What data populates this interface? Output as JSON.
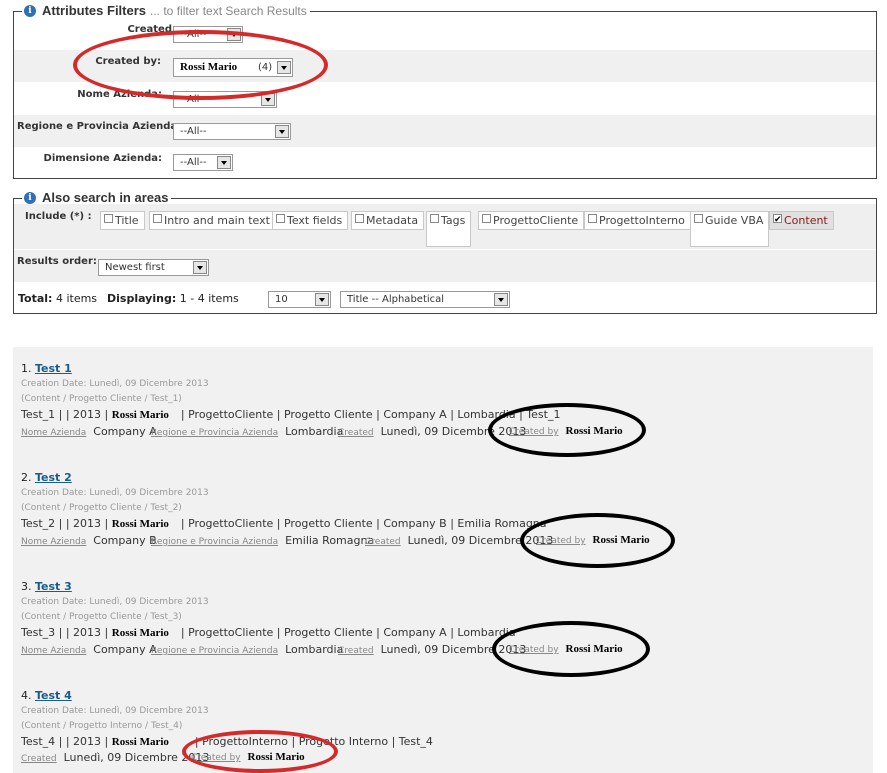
{
  "filters": {
    "legend_title": "Attributes Filters",
    "legend_sub": "... to filter text Search Results",
    "rows": [
      {
        "label": "Created:",
        "value": "--All--"
      },
      {
        "label": "Created by:",
        "value": "Rossi Mario",
        "count": "(4)"
      },
      {
        "label": "Nome Azienda:",
        "value": "--All--"
      },
      {
        "label": "Regione e Provincia Azienda:",
        "value": "--All--"
      },
      {
        "label": "Dimensione Azienda:",
        "value": "--All--"
      }
    ]
  },
  "areas": {
    "legend_title": "Also search in areas",
    "include_label": "Include (*) :",
    "checkboxes": [
      {
        "label": "Title",
        "checked": false
      },
      {
        "label": "Intro and main text",
        "checked": false
      },
      {
        "label": "Text fields",
        "checked": false
      },
      {
        "label": "Metadata",
        "checked": false
      },
      {
        "label": "Tags",
        "checked": false
      },
      {
        "label": "ProgettoCliente",
        "checked": false
      },
      {
        "label": "ProgettoInterno",
        "checked": false
      },
      {
        "label": "Guide VBA",
        "checked": false
      },
      {
        "label": "Content",
        "checked": true
      }
    ],
    "results_order_label": "Results order:",
    "results_order_value": "Newest first"
  },
  "summary": {
    "total_label": "Total:",
    "total_value": "4 items",
    "displaying_label": "Displaying:",
    "displaying_value": "1 - 4 items",
    "per_page": "10",
    "sort": "Title -- Alphabetical"
  },
  "results": [
    {
      "num": "1.",
      "title": "Test 1",
      "creation": "Creation Date: Lunedì, 09 Dicembre 2013",
      "path": "(Content / Progetto Cliente / Test_1)",
      "line_a": "Test_1 | | 2013 |",
      "author": "Rossi Mario",
      "line_b": "| ProgettoCliente | Progetto Cliente | Company A | Lombardia | Test_1",
      "attrs": [
        {
          "label": "Nome Azienda",
          "value": "Company A"
        },
        {
          "label": "Regione e Provincia Azienda",
          "value": "Lombardia"
        },
        {
          "label": "Created",
          "value": "Lunedì, 09 Dicembre 2013"
        },
        {
          "label": "Created by",
          "value": "Rossi Mario"
        }
      ]
    },
    {
      "num": "2.",
      "title": "Test 2",
      "creation": "Creation Date: Lunedì, 09 Dicembre 2013",
      "path": "(Content / Progetto Cliente / Test_2)",
      "line_a": "Test_2 | | 2013 |",
      "author": "Rossi Mario",
      "line_b": "| ProgettoCliente | Progetto Cliente | Company B | Emilia Romagna",
      "attrs": [
        {
          "label": "Nome Azienda",
          "value": "Company B"
        },
        {
          "label": "Regione e Provincia Azienda",
          "value": "Emilia Romagna"
        },
        {
          "label": "Created",
          "value": "Lunedì, 09 Dicembre 2013"
        },
        {
          "label": "Created by",
          "value": "Rossi Mario"
        }
      ]
    },
    {
      "num": "3.",
      "title": "Test 3",
      "creation": "Creation Date: Lunedì, 09 Dicembre 2013",
      "path": "(Content / Progetto Cliente / Test_3)",
      "line_a": "Test_3 | | 2013 |",
      "author": "Rossi Mario",
      "line_b": "| ProgettoCliente | Progetto Cliente | Company A | Lombardia",
      "attrs": [
        {
          "label": "Nome Azienda",
          "value": "Company A"
        },
        {
          "label": "Regione e Provincia Azienda",
          "value": "Lombardia"
        },
        {
          "label": "Created",
          "value": "Lunedì, 09 Dicembre 2013"
        },
        {
          "label": "Created by",
          "value": "Rossi Mario"
        }
      ]
    },
    {
      "num": "4.",
      "title": "Test 4",
      "creation": "Creation Date: Lunedì, 09 Dicembre 2013",
      "path": "(Content / Progetto Interno / Test_4)",
      "line_a": "Test_4 | | 2013 |",
      "author": "Rossi Mario",
      "line_b": "| ProgettoInterno | Progetto Interno | Test_4",
      "attrs": [
        {
          "label": "Created",
          "value": "Lunedì, 09 Dicembre 2013"
        },
        {
          "label": "Created by",
          "value": "Rossi Mario"
        }
      ]
    }
  ],
  "colors": {
    "annotation_red": "#d42a2a",
    "annotation_black": "#000000",
    "link": "#1a5c8c"
  }
}
